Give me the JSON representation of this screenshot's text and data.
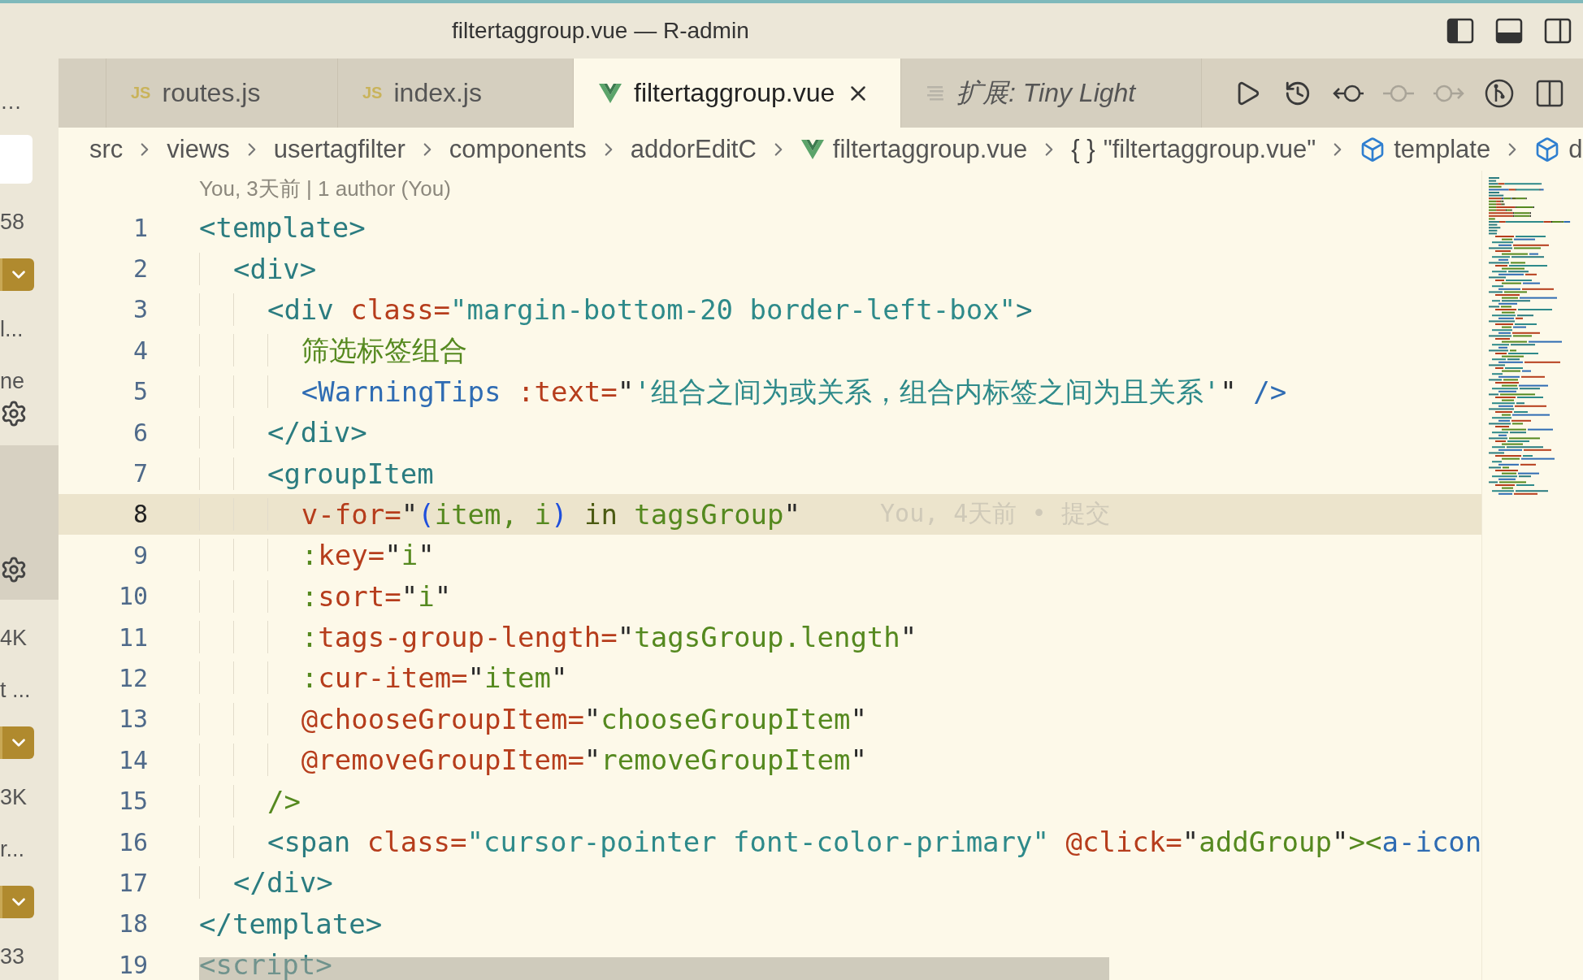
{
  "window": {
    "title": "filtertaggroup.vue — R-admin"
  },
  "sidebar": {
    "items": [
      {
        "kind": "label",
        "text": "…"
      },
      {
        "kind": "field"
      },
      {
        "kind": "label",
        "text": "58"
      },
      {
        "kind": "dropdown"
      },
      {
        "kind": "label",
        "text": "l..."
      },
      {
        "kind": "label",
        "text": "ne"
      },
      {
        "kind": "gear"
      },
      {
        "kind": "selected-block"
      },
      {
        "kind": "label",
        "text": "4K"
      },
      {
        "kind": "label",
        "text": "t ..."
      },
      {
        "kind": "dropdown"
      },
      {
        "kind": "label",
        "text": "3K"
      },
      {
        "kind": "label",
        "text": "r..."
      },
      {
        "kind": "dropdown"
      },
      {
        "kind": "label",
        "text": "33"
      }
    ]
  },
  "tabs": [
    {
      "kind": "js",
      "badge": "JS",
      "label": "routes.js",
      "selected": false
    },
    {
      "kind": "js",
      "badge": "JS",
      "label": "index.js",
      "selected": false
    },
    {
      "kind": "vue",
      "label": "filtertaggroup.vue",
      "selected": true
    },
    {
      "kind": "preview",
      "label": "扩展: Tiny Light",
      "selected": false
    }
  ],
  "editor_actions": [
    {
      "kind": "run",
      "disabled": false
    },
    {
      "kind": "history",
      "disabled": false
    },
    {
      "kind": "previous-change",
      "disabled": false
    },
    {
      "kind": "commit",
      "disabled": true
    },
    {
      "kind": "next-change",
      "disabled": true
    },
    {
      "kind": "graph",
      "disabled": false
    },
    {
      "kind": "split",
      "disabled": false
    }
  ],
  "breadcrumb": [
    {
      "kind": "folder",
      "label": "src"
    },
    {
      "kind": "folder",
      "label": "views"
    },
    {
      "kind": "folder",
      "label": "usertagfilter"
    },
    {
      "kind": "folder",
      "label": "components"
    },
    {
      "kind": "folder",
      "label": "addorEditC"
    },
    {
      "kind": "vue",
      "label": "filtertaggroup.vue"
    },
    {
      "kind": "object",
      "glyph": "{ }",
      "label": "\"filtertaggroup.vue\""
    },
    {
      "kind": "element",
      "label": "template"
    },
    {
      "kind": "element",
      "label": "d"
    }
  ],
  "code": {
    "blame_header": "You, 3天前 | 1 author (You)",
    "lines": [
      {
        "number": "1",
        "selected": false,
        "tokens": [
          {
            "kind": "tag",
            "text": "<template>"
          }
        ]
      },
      {
        "number": "2",
        "selected": false,
        "tokens": [
          {
            "kind": "tag",
            "text": "  <div>"
          }
        ]
      },
      {
        "number": "3",
        "selected": false,
        "tokens": [
          {
            "kind": "tag",
            "text": "    <div "
          },
          {
            "kind": "attr",
            "text": "class="
          },
          {
            "kind": "cls",
            "text": "\"margin-bottom-20 border-left-box\""
          },
          {
            "kind": "tag",
            "text": ">"
          }
        ]
      },
      {
        "number": "4",
        "selected": false,
        "tokens": [
          {
            "kind": "text",
            "text": "      筛选标签组合"
          }
        ]
      },
      {
        "number": "5",
        "selected": false,
        "tokens": [
          {
            "kind": "comp",
            "text": "      <WarningTips "
          },
          {
            "kind": "attr",
            "text": ":text="
          },
          {
            "kind": "quote",
            "text": "\""
          },
          {
            "kind": "cls",
            "text": "'组合之间为或关系，组合内标签之间为且关系'"
          },
          {
            "kind": "quote",
            "text": "\""
          },
          {
            "kind": "comp",
            "text": " />"
          }
        ]
      },
      {
        "number": "6",
        "selected": false,
        "tokens": [
          {
            "kind": "tag",
            "text": "    </div>"
          }
        ]
      },
      {
        "number": "7",
        "selected": false,
        "tokens": [
          {
            "kind": "tag",
            "text": "    <groupItem"
          }
        ]
      },
      {
        "number": "8",
        "selected": true,
        "blame": "You, 4天前 • 提交",
        "tokens": [
          {
            "kind": "attr",
            "text": "      v-for="
          },
          {
            "kind": "quote",
            "text": "\""
          },
          {
            "kind": "paren",
            "text": "("
          },
          {
            "kind": "str",
            "text": "item, i"
          },
          {
            "kind": "paren",
            "text": ")"
          },
          {
            "kind": "kw",
            "text": " in "
          },
          {
            "kind": "str",
            "text": "tagsGroup"
          },
          {
            "kind": "quote",
            "text": "\""
          }
        ]
      },
      {
        "number": "9",
        "selected": false,
        "tokens": [
          {
            "kind": "str",
            "text": "      :"
          },
          {
            "kind": "attr",
            "text": "key="
          },
          {
            "kind": "quote",
            "text": "\""
          },
          {
            "kind": "str",
            "text": "i"
          },
          {
            "kind": "quote",
            "text": "\""
          }
        ]
      },
      {
        "number": "10",
        "selected": false,
        "tokens": [
          {
            "kind": "str",
            "text": "      :"
          },
          {
            "kind": "attr",
            "text": "sort="
          },
          {
            "kind": "quote",
            "text": "\""
          },
          {
            "kind": "str",
            "text": "i"
          },
          {
            "kind": "quote",
            "text": "\""
          }
        ]
      },
      {
        "number": "11",
        "selected": false,
        "tokens": [
          {
            "kind": "str",
            "text": "      :"
          },
          {
            "kind": "attr",
            "text": "tags-group-length="
          },
          {
            "kind": "quote",
            "text": "\""
          },
          {
            "kind": "str",
            "text": "tagsGroup.length"
          },
          {
            "kind": "quote",
            "text": "\""
          }
        ]
      },
      {
        "number": "12",
        "selected": false,
        "tokens": [
          {
            "kind": "str",
            "text": "      :"
          },
          {
            "kind": "attr",
            "text": "cur-item="
          },
          {
            "kind": "quote",
            "text": "\""
          },
          {
            "kind": "str",
            "text": "item"
          },
          {
            "kind": "quote",
            "text": "\""
          }
        ]
      },
      {
        "number": "13",
        "selected": false,
        "tokens": [
          {
            "kind": "attr",
            "text": "      @chooseGroupItem="
          },
          {
            "kind": "quote",
            "text": "\""
          },
          {
            "kind": "str",
            "text": "chooseGroupItem"
          },
          {
            "kind": "quote",
            "text": "\""
          }
        ]
      },
      {
        "number": "14",
        "selected": false,
        "tokens": [
          {
            "kind": "attr",
            "text": "      @removeGroupItem="
          },
          {
            "kind": "quote",
            "text": "\""
          },
          {
            "kind": "str",
            "text": "removeGroupItem"
          },
          {
            "kind": "quote",
            "text": "\""
          }
        ]
      },
      {
        "number": "15",
        "selected": false,
        "tokens": [
          {
            "kind": "str",
            "text": "    />"
          }
        ]
      },
      {
        "number": "16",
        "selected": false,
        "tokens": [
          {
            "kind": "tag",
            "text": "    <span "
          },
          {
            "kind": "attr",
            "text": "class="
          },
          {
            "kind": "cls",
            "text": "\"cursor-pointer font-color-primary\" "
          },
          {
            "kind": "attr",
            "text": "@click="
          },
          {
            "kind": "quote",
            "text": "\""
          },
          {
            "kind": "str",
            "text": "addGroup"
          },
          {
            "kind": "quote",
            "text": "\""
          },
          {
            "kind": "str",
            "text": "><"
          },
          {
            "kind": "comp",
            "text": "a-icon"
          }
        ]
      },
      {
        "number": "17",
        "selected": false,
        "tokens": [
          {
            "kind": "tag",
            "text": "  </div>"
          }
        ]
      },
      {
        "number": "18",
        "selected": false,
        "tokens": [
          {
            "kind": "tag",
            "text": "</template>"
          }
        ]
      },
      {
        "number": "19",
        "selected": false,
        "tokens": [
          {
            "kind": "tag",
            "text": "<script>"
          }
        ]
      }
    ]
  }
}
